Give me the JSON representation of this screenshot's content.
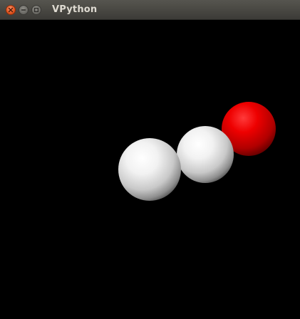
{
  "window": {
    "title": "VPython"
  },
  "titlebar_buttons": {
    "close_icon": "close-icon",
    "minimize_icon": "minimize-icon",
    "maximize_icon": "maximize-icon"
  },
  "scene": {
    "background": "#000000",
    "objects": [
      {
        "name": "sphere-white-large",
        "color": "#ffffff"
      },
      {
        "name": "sphere-white-medium",
        "color": "#ffffff"
      },
      {
        "name": "sphere-red",
        "color": "#ff0000"
      }
    ]
  }
}
